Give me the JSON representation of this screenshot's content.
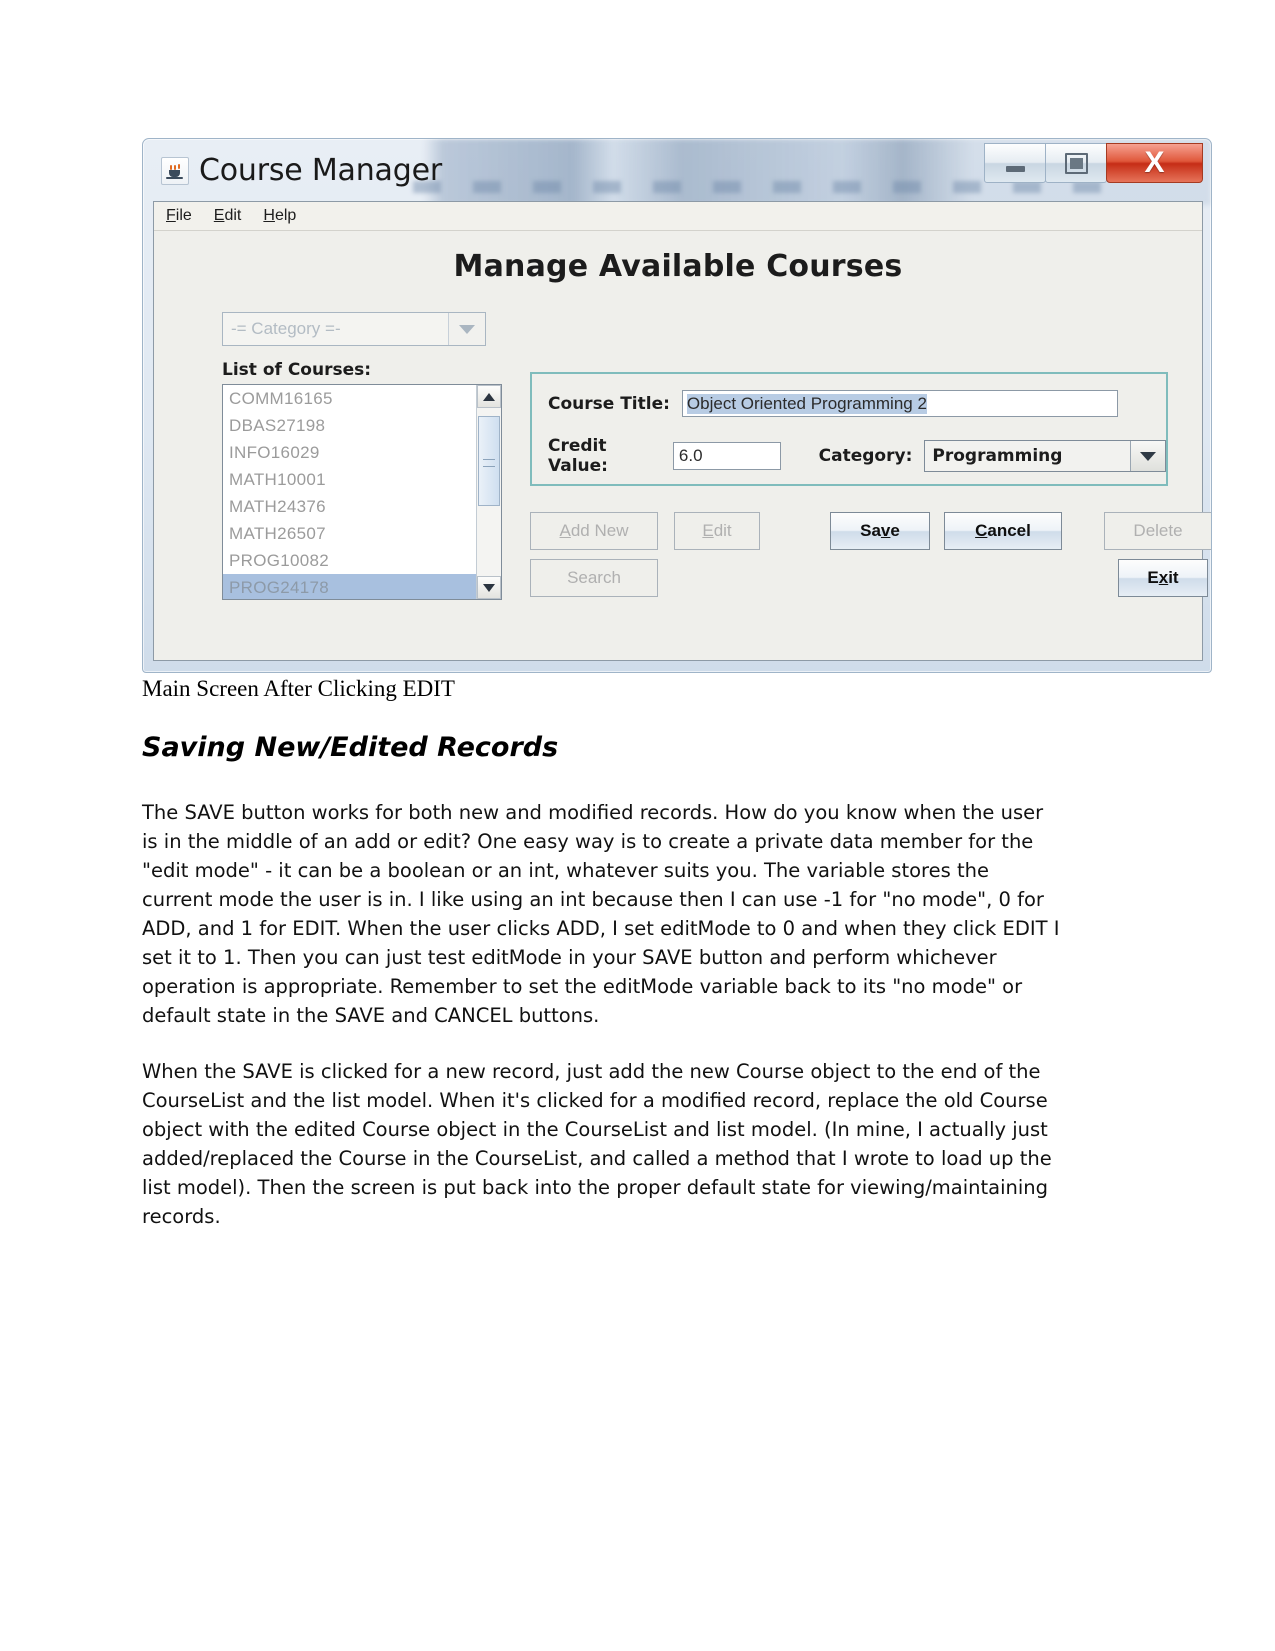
{
  "window": {
    "title": "Course Manager",
    "icon": "java-cup-icon",
    "controls": {
      "minimize": "minimize-icon",
      "maximize": "maximize-icon",
      "close": "X"
    }
  },
  "menubar": {
    "items": [
      {
        "label": "File",
        "mnemonic": "F",
        "rest": "ile"
      },
      {
        "label": "Edit",
        "mnemonic": "E",
        "rest": "dit"
      },
      {
        "label": "Help",
        "mnemonic": "H",
        "rest": "elp"
      }
    ]
  },
  "main": {
    "heading": "Manage Available Courses",
    "category_filter": {
      "value": "-= Category =-",
      "enabled": false
    },
    "list": {
      "label": "List of Courses:",
      "items": [
        "COMM16165",
        "DBAS27198",
        "INFO16029",
        "MATH10001",
        "MATH24376",
        "MATH26507",
        "PROG10082",
        "PROG24178"
      ],
      "selected": "PROG24178",
      "selected_index": 7,
      "enabled": false
    },
    "form": {
      "course_title_label": "Course Title:",
      "course_title_value": "Object Oriented Programming 2",
      "course_title_selected": true,
      "credit_value_label": "Credit Value:",
      "credit_value": "6.0",
      "category_label": "Category:",
      "category_value": "Programming"
    },
    "buttons": [
      {
        "name": "add-new",
        "label": "Add New",
        "mnemonic": "A",
        "before": "",
        "after": "dd New",
        "enabled": false
      },
      {
        "name": "edit",
        "label": "Edit",
        "mnemonic": "E",
        "before": "",
        "after": "dit",
        "enabled": false
      },
      {
        "name": "search",
        "label": "Search",
        "mnemonic": "",
        "before": "Search",
        "after": "",
        "enabled": false
      },
      {
        "name": "save",
        "label": "Save",
        "mnemonic": "v",
        "before": "Sa",
        "after": "e",
        "enabled": true
      },
      {
        "name": "cancel",
        "label": "Cancel",
        "mnemonic": "C",
        "before": "",
        "after": "ancel",
        "enabled": true
      },
      {
        "name": "delete",
        "label": "Delete",
        "mnemonic": "",
        "before": "Delete",
        "after": "",
        "enabled": false
      },
      {
        "name": "exit",
        "label": "Exit",
        "mnemonic": "x",
        "before": "E",
        "after": "it",
        "enabled": true
      }
    ]
  },
  "document": {
    "caption": "Main Screen After Clicking EDIT",
    "section_heading": "Saving New/Edited Records",
    "paragraph_1": "The SAVE button works for both new and modified records. How do you know when the user is in the middle of an add or edit? One easy way is to create a private data member for the \"edit mode\" - it can be a boolean or an int, whatever suits you. The variable stores the current mode the user is in. I like using an int because then I can use -1 for \"no mode\", 0 for ADD, and 1 for EDIT. When the user clicks ADD, I set editMode to 0 and when they click EDIT I set it to 1. Then you can just test editMode in your SAVE button and perform whichever operation is appropriate. Remember to set the editMode variable back to its \"no mode\" or default state in the SAVE and CANCEL buttons.",
    "paragraph_2": "When the SAVE is clicked for a new record, just add the new Course object to the end of the CourseList and the list model. When it's clicked for a modified record, replace the old Course object with the edited Course object in the CourseList and list model. (In mine, I actually just added/replaced the Course in the CourseList, and called a method that I wrote to load up the list model). Then the screen is put back into the proper default state for viewing/maintaining records."
  },
  "colors": {
    "close_button": "#c62d16",
    "form_border": "#7fbcbc",
    "selection": "#b8cce4",
    "list_selection": "#a8c0df"
  }
}
